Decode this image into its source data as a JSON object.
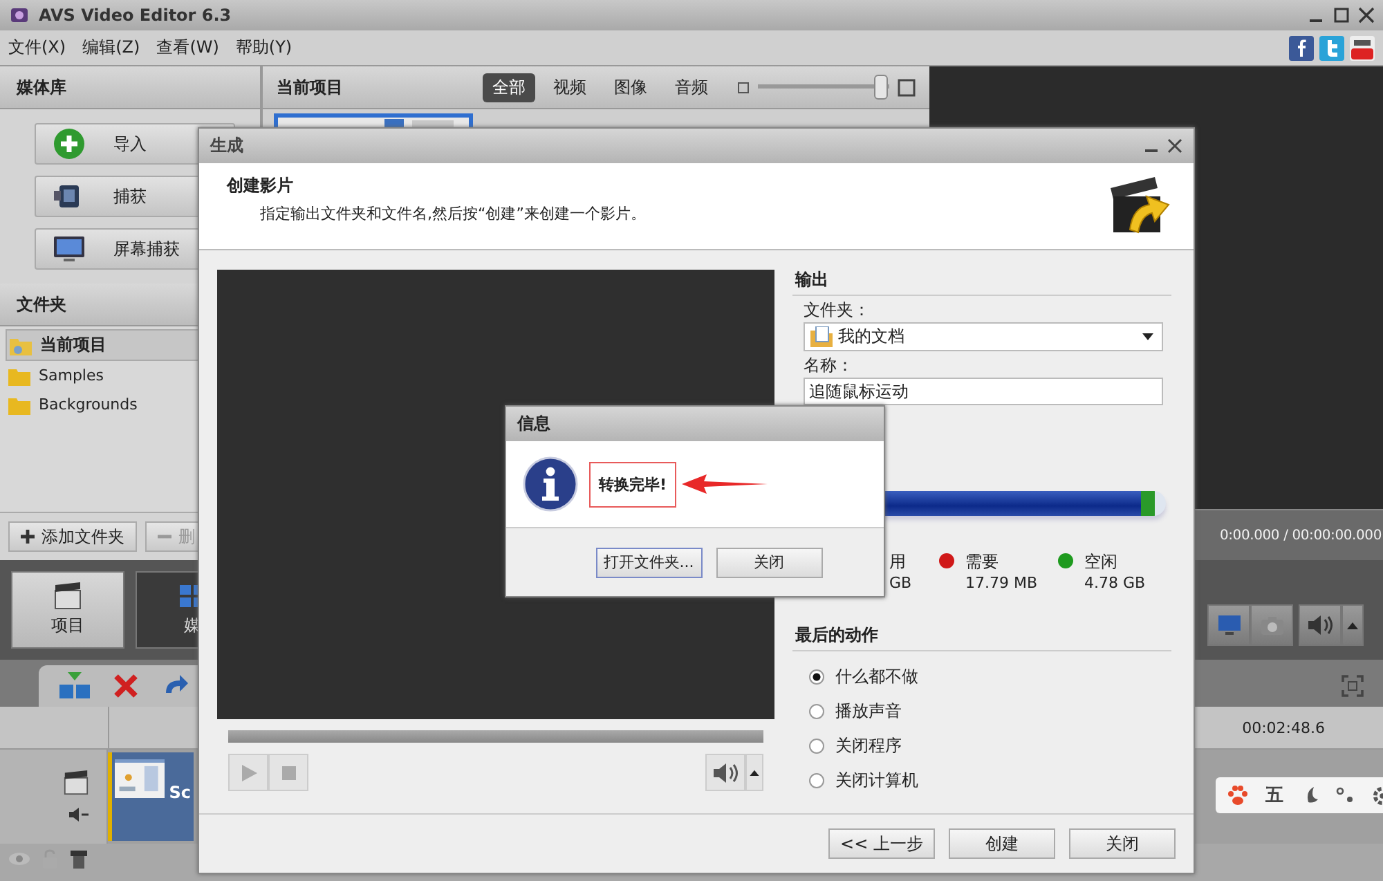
{
  "window": {
    "title": "AVS Video Editor 6.3"
  },
  "menu": [
    "文件(X)",
    "编辑(Z)",
    "查看(W)",
    "帮助(Y)"
  ],
  "media_library": {
    "title": "媒体库",
    "buttons": [
      {
        "kind": "import",
        "label": "导入"
      },
      {
        "kind": "capture",
        "label": "捕获"
      },
      {
        "kind": "screen",
        "label": "屏幕捕获"
      }
    ]
  },
  "folders": {
    "title": "文件夹",
    "items": [
      {
        "kind": "project",
        "label": "当前项目",
        "selected": true
      },
      {
        "kind": "folder",
        "label": "Samples",
        "selected": false
      },
      {
        "kind": "folder",
        "label": "Backgrounds",
        "selected": false
      }
    ],
    "add_button": "添加文件夹",
    "delete_button": "删"
  },
  "project": {
    "title": "当前项目",
    "tabs": [
      {
        "label": "全部",
        "selected": true
      },
      {
        "label": "视频",
        "selected": false
      },
      {
        "label": "图像",
        "selected": false
      },
      {
        "label": "音频",
        "selected": false
      }
    ],
    "zoom": {
      "level": 0.94
    }
  },
  "preview": {
    "time": "0:00.000 / 00:00:00.000"
  },
  "modes": [
    {
      "label": "项目",
      "selected": false
    },
    {
      "label": "媒",
      "selected": true
    }
  ],
  "timeline": {
    "time": "00:02:48.6",
    "clip_label": "Sc"
  },
  "ime": {
    "label": "五"
  },
  "dialog": {
    "title": "生成",
    "heading": "创建影片",
    "description": "指定输出文件夹和文件名,然后按“创建”来创建一个影片。",
    "output": {
      "title": "输出",
      "folder_label": "文件夹：",
      "folder": "我的文档",
      "name_label": "名称：",
      "name": "追随鼠标运动"
    },
    "playback": {
      "level": 0
    },
    "disk": {
      "level": 0.97,
      "legend": [
        {
          "label": "用",
          "value": "GB"
        },
        {
          "label": "需要",
          "value": "17.79 MB",
          "color": "#d01818"
        },
        {
          "label": "空闲",
          "value": "4.78 GB",
          "color": "#1e9a1e"
        }
      ]
    },
    "last_action": {
      "title": "最后的动作",
      "options": [
        {
          "label": "什么都不做",
          "selected": true
        },
        {
          "label": "播放声音",
          "selected": false
        },
        {
          "label": "关闭程序",
          "selected": false
        },
        {
          "label": "关闭计算机",
          "selected": false
        }
      ]
    },
    "buttons": [
      "<< 上一步",
      "创建",
      "关闭"
    ]
  },
  "message": {
    "title": "信息",
    "text": "转换完毕!",
    "buttons": [
      "打开文件夹...",
      "关闭"
    ]
  }
}
